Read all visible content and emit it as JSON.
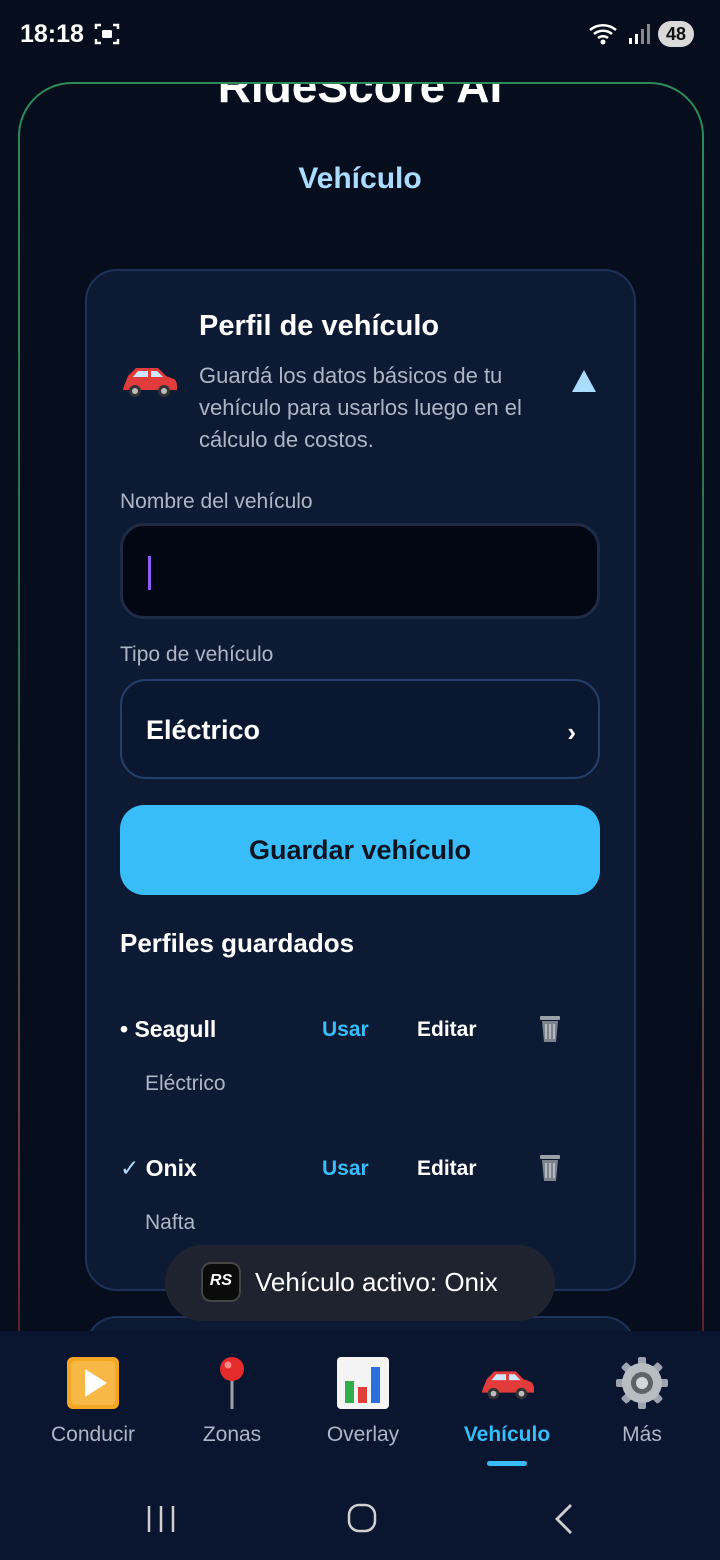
{
  "status_bar": {
    "time": "18:18",
    "battery": "48"
  },
  "app": {
    "name": "RideScore AI",
    "section_title": "Vehículo"
  },
  "profile_card": {
    "title": "Perfil de vehículo",
    "description": "Guardá los datos básicos de tu vehículo para usarlos luego en el cálculo de costos.",
    "name_label": "Nombre del vehículo",
    "name_value": "",
    "type_label": "Tipo de vehículo",
    "type_value": "Eléctrico",
    "save_button": "Guardar vehículo",
    "saved_title": "Perfiles guardados",
    "profiles": [
      {
        "marker": "•",
        "name": "Seagull",
        "type": "Eléctrico",
        "use_label": "Usar",
        "edit_label": "Editar"
      },
      {
        "marker": "✓",
        "name": "Onix",
        "type": "Nafta",
        "use_label": "Usar",
        "edit_label": "Editar"
      }
    ]
  },
  "toast": {
    "logo": "RS",
    "text": "Vehículo activo: Onix"
  },
  "bottom_nav": [
    {
      "label": "Conducir",
      "icon": "play-icon"
    },
    {
      "label": "Zonas",
      "icon": "pin-icon"
    },
    {
      "label": "Overlay",
      "icon": "bar-chart-icon"
    },
    {
      "label": "Vehículo",
      "icon": "car-icon",
      "active": true
    },
    {
      "label": "Más",
      "icon": "gear-icon"
    }
  ],
  "colors": {
    "accent": "#38bdf8",
    "background": "#060d1c",
    "card": "#0d1a33"
  }
}
